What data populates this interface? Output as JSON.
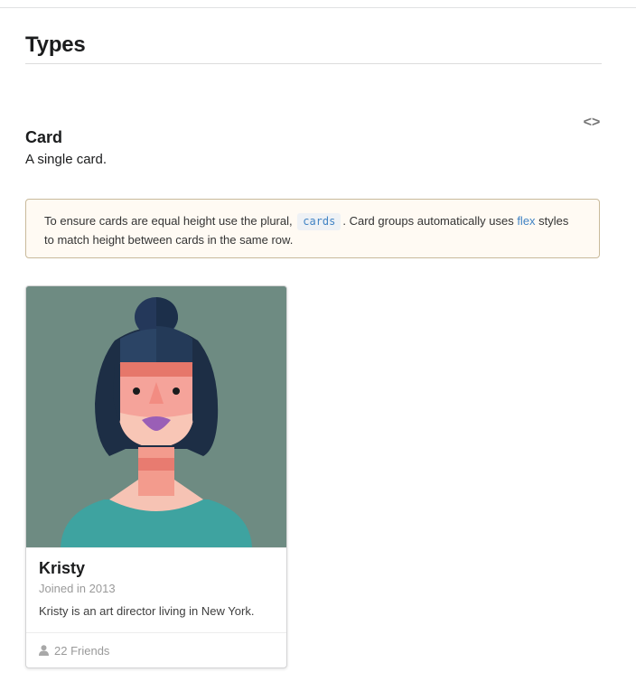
{
  "section": {
    "title": "Types"
  },
  "example": {
    "title": "Card",
    "description": "A single card.",
    "code_toggle_icon": "code-brackets-icon",
    "code_toggle_glyph": "<>"
  },
  "tip": {
    "text_before": "To ensure cards are equal height use the plural,",
    "code": "cards",
    "text_middle": ". Card groups automatically uses",
    "link": "flex",
    "text_after": "styles to match height between cards in the same row."
  },
  "card": {
    "image": "kristy-avatar-illustration",
    "header": "Kristy",
    "meta": "Joined in 2013",
    "description": "Kristy is an art director living in New York.",
    "extra_icon": "user-icon",
    "extra_text": "22 Friends"
  },
  "colors": {
    "tip_background": "#fffaf3",
    "tip_border": "#c9ba9b",
    "link": "#4183c4",
    "image_background": "#6e8b82",
    "meta_text": "#9a9a9a"
  }
}
